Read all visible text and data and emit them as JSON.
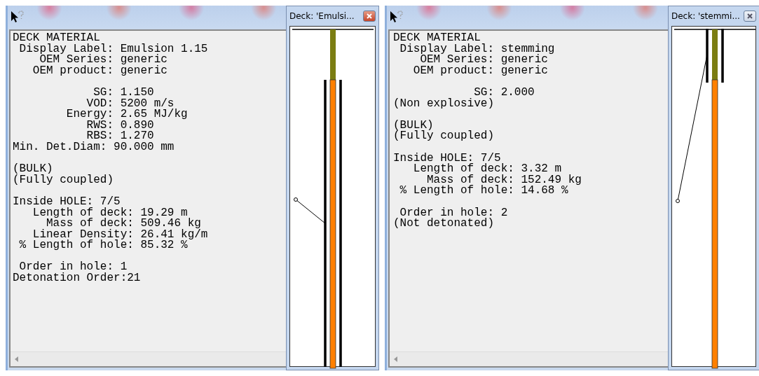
{
  "panels": [
    {
      "info_sections": [
        [
          "DECK MATERIAL",
          " Display Label: Emulsion 1.15",
          "    OEM Series: generic",
          "   OEM product: generic"
        ],
        [
          "            SG: 1.150",
          "           VOD: 5200 m/s",
          "        Energy: 2.65 MJ/kg",
          "           RWS: 0.890",
          "           RBS: 1.270",
          "Min. Det.Diam: 90.000 mm"
        ],
        [
          "(BULK)",
          "(Fully coupled)"
        ],
        [
          "Inside HOLE: 7/5",
          "   Length of deck: 19.29 m",
          "     Mass of deck: 509.46 kg",
          "   Linear Density: 26.41 kg/m",
          " % Length of hole: 85.32 %"
        ],
        [
          " Order in hole: 1",
          "Detonation Order:21"
        ]
      ],
      "deck_window": {
        "title": "Deck: 'Emulsi...",
        "active": true,
        "kind": "explosive"
      }
    },
    {
      "info_sections": [
        [
          "DECK MATERIAL",
          " Display Label: stemming",
          "    OEM Series: generic",
          "   OEM product: generic"
        ],
        [
          "            SG: 2.000",
          "(Non explosive)"
        ],
        [
          "(BULK)",
          "(Fully coupled)"
        ],
        [
          "Inside HOLE: 7/5",
          "   Length of deck: 3.32 m",
          "     Mass of deck: 152.49 kg",
          " % Length of hole: 14.68 %"
        ],
        [
          " Order in hole: 2",
          "(Not detonated)"
        ]
      ],
      "deck_window": {
        "title": "Deck: 'stemmi...",
        "active": false,
        "kind": "stemming"
      }
    }
  ]
}
